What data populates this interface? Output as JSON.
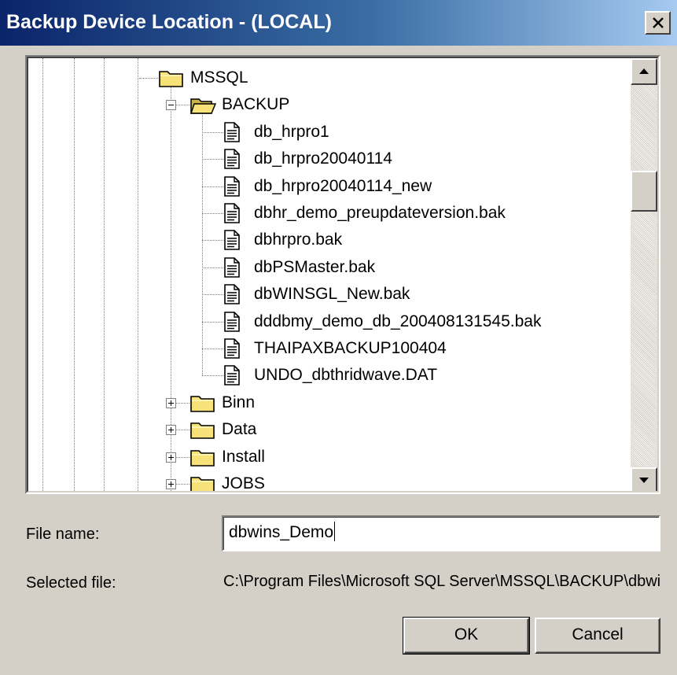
{
  "window": {
    "title": "Backup Device Location - (LOCAL)"
  },
  "tree": {
    "nodes": [
      {
        "label": "MSSQL",
        "type": "folder",
        "state": "expanded",
        "level": 0
      },
      {
        "label": "BACKUP",
        "type": "folder-open",
        "state": "expanded",
        "level": 1
      },
      {
        "label": "db_hrpro1",
        "type": "file",
        "level": 2
      },
      {
        "label": "db_hrpro20040114",
        "type": "file",
        "level": 2
      },
      {
        "label": "db_hrpro20040114_new",
        "type": "file",
        "level": 2
      },
      {
        "label": "dbhr_demo_preupdateversion.bak",
        "type": "file",
        "level": 2
      },
      {
        "label": "dbhrpro.bak",
        "type": "file",
        "level": 2
      },
      {
        "label": "dbPSMaster.bak",
        "type": "file",
        "level": 2
      },
      {
        "label": "dbWINSGL_New.bak",
        "type": "file",
        "level": 2
      },
      {
        "label": "dddbmy_demo_db_200408131545.bak",
        "type": "file",
        "level": 2
      },
      {
        "label": "THAIPAXBACKUP100404",
        "type": "file",
        "level": 2
      },
      {
        "label": "UNDO_dbthridwave.DAT",
        "type": "file",
        "level": 2
      },
      {
        "label": "Binn",
        "type": "folder",
        "state": "collapsed",
        "level": 1
      },
      {
        "label": "Data",
        "type": "folder",
        "state": "collapsed",
        "level": 1
      },
      {
        "label": "Install",
        "type": "folder",
        "state": "collapsed",
        "level": 1
      },
      {
        "label": "JOBS",
        "type": "folder",
        "state": "collapsed",
        "level": 1
      }
    ]
  },
  "form": {
    "file_name_label": "File name:",
    "file_name_value": "dbwins_Demo",
    "selected_file_label": "Selected file:",
    "selected_file_value": "C:\\Program Files\\Microsoft SQL Server\\MSSQL\\BACKUP\\dbwins_Demo"
  },
  "buttons": {
    "ok": "OK",
    "cancel": "Cancel"
  },
  "colors": {
    "title_start": "#0a246a",
    "title_end": "#a6caf0",
    "face": "#d4d0c8",
    "folder": "#f7e27a"
  },
  "icons": {
    "close": "close-icon",
    "scroll_up": "arrow-up-icon",
    "scroll_down": "arrow-down-icon",
    "folder": "folder-icon",
    "folder_open": "folder-open-icon",
    "file": "document-icon",
    "expand": "plus-box-icon",
    "collapse": "minus-box-icon"
  }
}
